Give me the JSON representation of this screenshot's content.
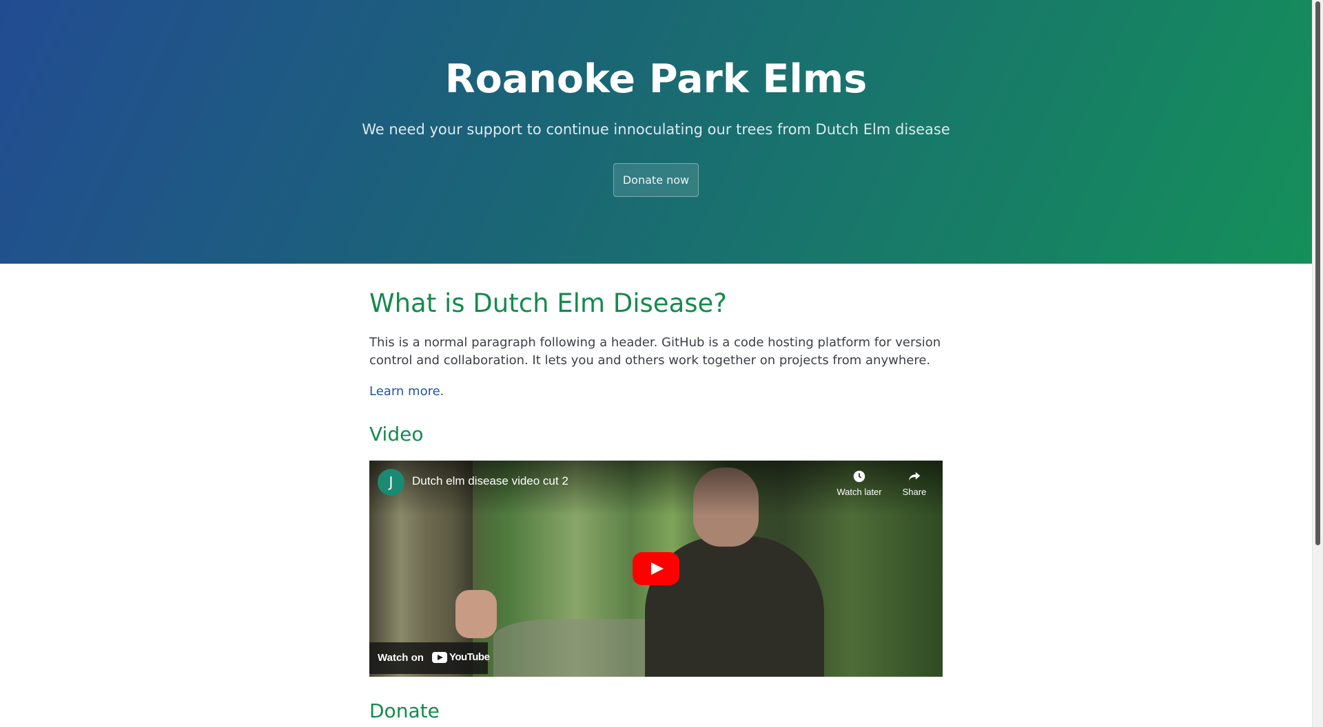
{
  "hero": {
    "title": "Roanoke Park Elms",
    "subtitle": "We need your support to continue innoculating our trees from Dutch Elm disease",
    "donate_button": "Donate now"
  },
  "content": {
    "heading": "What is Dutch Elm Disease?",
    "paragraph": "This is a normal paragraph following a header. GitHub is a code hosting platform for version control and collaboration. It lets you and others work together on projects from anywhere.",
    "learn_more": "Learn more",
    "learn_more_suffix": ".",
    "video_heading": "Video",
    "donate_heading": "Donate"
  },
  "video": {
    "channel_initial": "J",
    "title": "Dutch elm disease video cut 2",
    "watch_later": "Watch later",
    "share": "Share",
    "watch_on": "Watch on",
    "youtube": "YouTube"
  },
  "colors": {
    "hero_gradient_start": "#224c92",
    "hero_gradient_end": "#15905a",
    "heading": "#158a4c",
    "link": "#1f55a8",
    "play_button": "#ff0000"
  }
}
